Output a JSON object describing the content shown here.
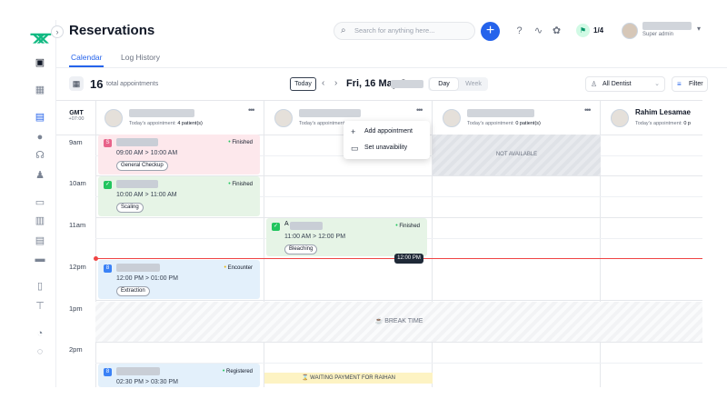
{
  "app": {
    "title": "Reservations"
  },
  "search": {
    "placeholder": "Search for anything here..."
  },
  "header": {
    "flag_count": "1/4",
    "user_role": "Super admin"
  },
  "tabs": [
    {
      "label": "Calendar"
    },
    {
      "label": "Log History"
    }
  ],
  "toolbar": {
    "count": "16",
    "count_label": "total appointments",
    "today": "Today",
    "date": "Fri, 16 May 2",
    "view_day": "Day",
    "view_week": "Week",
    "dentist_select": "All Dentist",
    "filter": "Filter"
  },
  "grid": {
    "gmt": "GMT",
    "gmt_offset": "+07:00",
    "hours": [
      "9am",
      "10am",
      "11am",
      "12pm",
      "1pm",
      "2pm"
    ],
    "dentists": [
      {
        "sub": "Today's appointment:",
        "count": "4 patient(s)"
      },
      {
        "sub": "Today's appointment:",
        "count": ""
      },
      {
        "sub": "Today's appointment:",
        "count": "0 patient(s)"
      },
      {
        "name": "Rahim Lesamae",
        "sub": "Today's appointment:",
        "count": "0 p"
      }
    ]
  },
  "appointments": [
    {
      "badge": "S",
      "badge_color": "#e8638a",
      "time_start": "09:00 AM",
      "time_end": "10:00 AM",
      "tag": "General Checkup",
      "status": "Finished",
      "status_color": "#22c55e"
    },
    {
      "badge": "✓",
      "badge_color": "#22c55e",
      "time_start": "10:00 AM",
      "time_end": "11:00 AM",
      "tag": "Scaling",
      "status": "Finished",
      "status_color": "#22c55e"
    },
    {
      "badge": "✓",
      "badge_color": "#22c55e",
      "name_initial": "A",
      "time_start": "11:00 AM",
      "time_end": "12:00 PM",
      "tag": "Bleaching",
      "status": "Finished",
      "status_color": "#22c55e"
    },
    {
      "badge": "8",
      "badge_color": "#3b82f6",
      "time_start": "12:00 PM",
      "time_end": "01:00 PM",
      "tag": "Extraction",
      "status": "Encounter",
      "status_color": "#eab308"
    },
    {
      "badge": "8",
      "badge_color": "#3b82f6",
      "time_start": "02:30 PM",
      "time_end": "03:30 PM",
      "tag": "",
      "status": "Registered",
      "status_color": "#22c55e"
    }
  ],
  "labels": {
    "not_available": "NOT AVAILABLE",
    "break_time": "BREAK TIME",
    "waiting": "WAITING PAYMENT FOR RAIHAN",
    "current_time": "12:00 PM",
    "arrow": ">"
  },
  "context_menu": [
    {
      "label": "Add appointment"
    },
    {
      "label": "Set unavaibility"
    }
  ],
  "colors": {
    "accent": "#2563eb",
    "brand": "#10b981",
    "now_line": "#ef4444"
  }
}
